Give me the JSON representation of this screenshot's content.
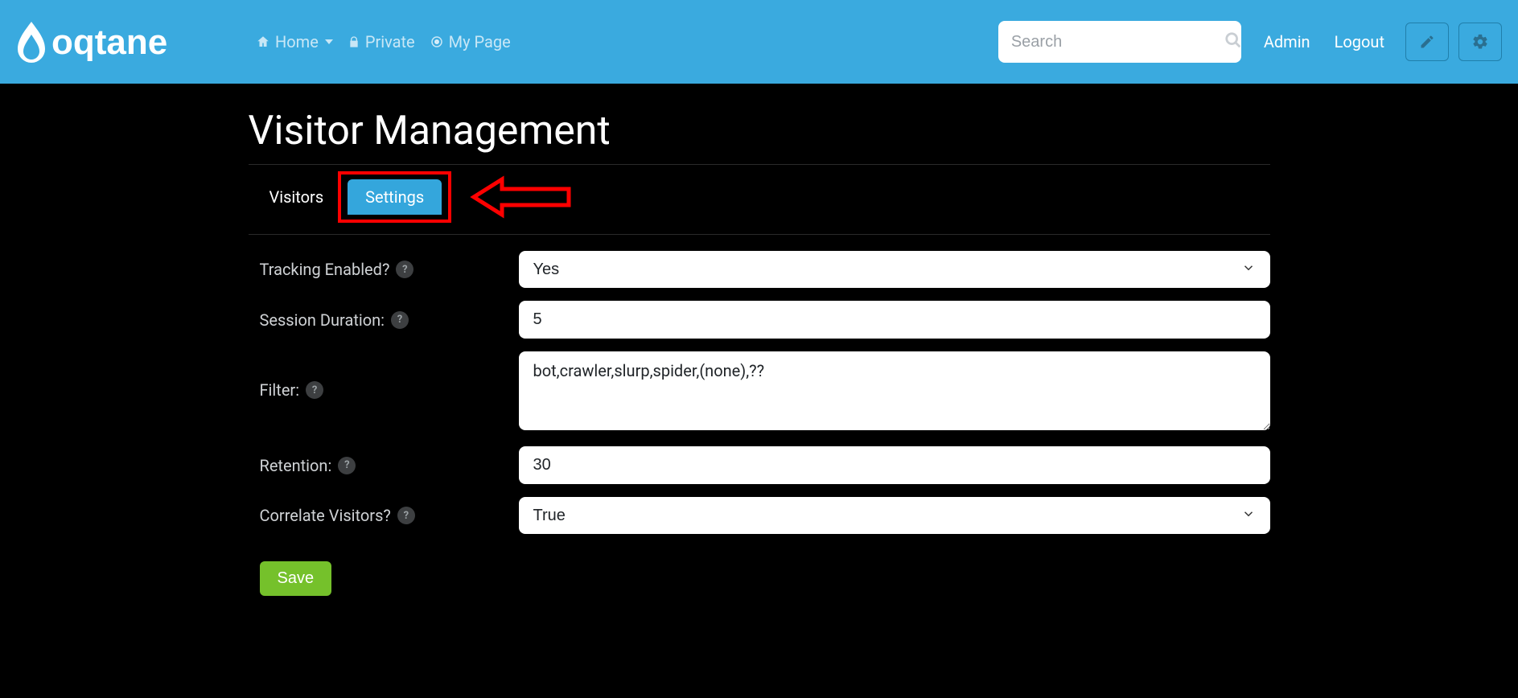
{
  "brand": {
    "name": "oqtane"
  },
  "nav": {
    "home": "Home",
    "private": "Private",
    "mypage": "My Page"
  },
  "search": {
    "placeholder": "Search"
  },
  "auth": {
    "admin": "Admin",
    "logout": "Logout"
  },
  "page": {
    "title": "Visitor Management",
    "tabs": {
      "visitors": "Visitors",
      "settings": "Settings"
    }
  },
  "form": {
    "tracking": {
      "label": "Tracking Enabled?",
      "value": "Yes"
    },
    "session": {
      "label": "Session Duration:",
      "value": "5"
    },
    "filter": {
      "label": "Filter:",
      "value": "bot,crawler,slurp,spider,(none),??"
    },
    "retention": {
      "label": "Retention:",
      "value": "30"
    },
    "correlate": {
      "label": "Correlate Visitors?",
      "value": "True"
    },
    "save": "Save"
  },
  "colors": {
    "navbar": "#3aaadf",
    "accent_red": "#ff0000",
    "save_green": "#75c12b"
  }
}
